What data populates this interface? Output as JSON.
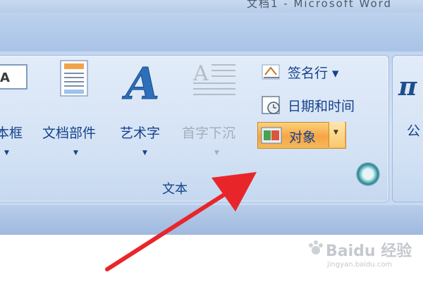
{
  "window": {
    "title_partial": "文档1 - Microsoft Word"
  },
  "ribbon": {
    "text_group": {
      "label": "文本",
      "buttons": [
        {
          "label": "本框",
          "icon": "text-box-icon",
          "enabled": true
        },
        {
          "label": "文档部件",
          "icon": "quick-parts-icon",
          "enabled": true
        },
        {
          "label": "艺术字",
          "icon": "wordart-icon",
          "enabled": true
        },
        {
          "label": "首字下沉",
          "icon": "drop-cap-icon",
          "enabled": false
        }
      ],
      "small_buttons": [
        {
          "label": "签名行 ▾",
          "icon": "signature-line-icon"
        },
        {
          "label": "日期和时间",
          "icon": "date-time-icon"
        },
        {
          "label": "对象",
          "icon": "object-icon",
          "highlighted": true
        }
      ]
    },
    "next_group": {
      "partial_label": "公"
    }
  },
  "watermark": {
    "brand": "Baidu 经验",
    "url": "jingyan.baidu.com"
  },
  "colors": {
    "ribbon_label": "#15428b",
    "highlight": "#f7a545",
    "arrow": "#e8262a"
  }
}
